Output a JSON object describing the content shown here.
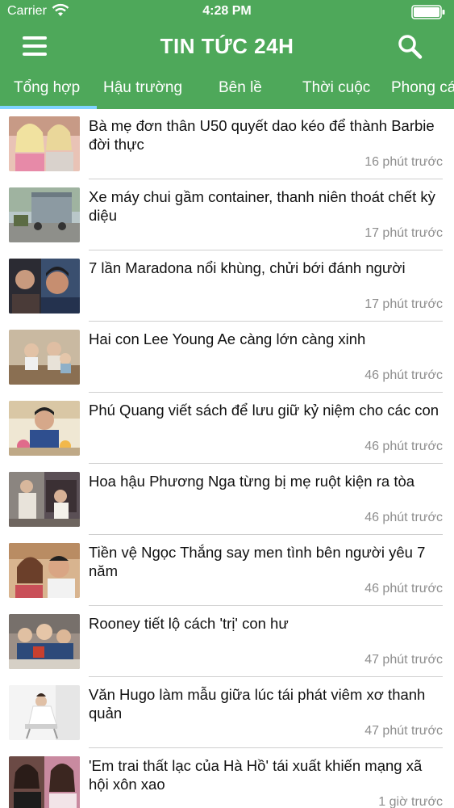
{
  "status_bar": {
    "carrier": "Carrier",
    "time": "4:28 PM",
    "wifi_icon": "wifi-icon",
    "battery_icon": "battery-icon"
  },
  "header": {
    "title": "TIN TỨC 24H",
    "menu_icon": "hamburger-menu-icon",
    "search_icon": "search-icon",
    "background_color": "#4ea85a",
    "active_tab_indicator_color": "#7fd3ff"
  },
  "tabs": [
    {
      "label": "Tổng hợp",
      "active": true
    },
    {
      "label": "Hậu trường",
      "active": false
    },
    {
      "label": "Bên lề",
      "active": false
    },
    {
      "label": "Thời cuộc",
      "active": false
    },
    {
      "label": "Phong cách",
      "active": false
    }
  ],
  "articles": [
    {
      "title": "Bà mẹ đơn thân U50 quyết dao kéo để thành Barbie đời thực",
      "time": "16 phút trước"
    },
    {
      "title": "Xe máy chui gầm container, thanh niên thoát chết kỳ diệu",
      "time": "17 phút trước"
    },
    {
      "title": "7 lần Maradona nổi khùng, chửi bới đánh người",
      "time": "17 phút trước"
    },
    {
      "title": "Hai con Lee Young Ae càng lớn càng xinh",
      "time": "46 phút trước"
    },
    {
      "title": "Phú Quang viết sách để lưu giữ kỷ niệm cho các con",
      "time": "46 phút trước"
    },
    {
      "title": "Hoa hậu Phương Nga từng bị mẹ ruột kiện ra tòa",
      "time": "46 phút trước"
    },
    {
      "title": "Tiền vệ Ngọc Thắng say men tình bên người yêu 7 năm",
      "time": "46 phút trước"
    },
    {
      "title": "Rooney tiết lộ cách 'trị' con hư",
      "time": "47 phút trước"
    },
    {
      "title": "Văn Hugo làm mẫu giữa lúc tái phát viêm xơ thanh quản",
      "time": "47 phút trước"
    },
    {
      "title": "'Em trai thất lạc của Hà Hồ' tái xuất khiến mạng xã hội xôn xao",
      "time": "1 giờ trước"
    }
  ]
}
